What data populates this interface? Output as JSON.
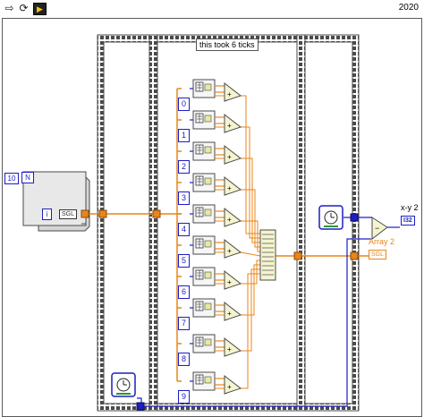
{
  "toolbar": {
    "buttons": [
      {
        "icon": "run-arrow-icon",
        "glyph": "⇨"
      },
      {
        "icon": "run-continuously-icon",
        "glyph": "⟳"
      },
      {
        "icon": "abort-icon",
        "glyph": "■"
      },
      {
        "icon": "pause-icon",
        "glyph": "▶"
      }
    ],
    "version": "2020"
  },
  "diagram": {
    "frame_label": "this took 6 ticks",
    "loop_count": "10",
    "loop_count_terminal": "N",
    "loop_index_terminal": "i",
    "sgl_tag": "SGL",
    "indices": [
      "0",
      "1",
      "2",
      "3",
      "4",
      "5",
      "6",
      "7",
      "8",
      "9"
    ],
    "outputs": [
      {
        "label": "x-y 2",
        "type": "I32"
      },
      {
        "label": "Array 2",
        "type": "SGL"
      }
    ],
    "colors": {
      "wire_orange": "#e8861a",
      "wire_blue": "#1d1dc4",
      "frame_border": "#4a4a4a"
    }
  }
}
